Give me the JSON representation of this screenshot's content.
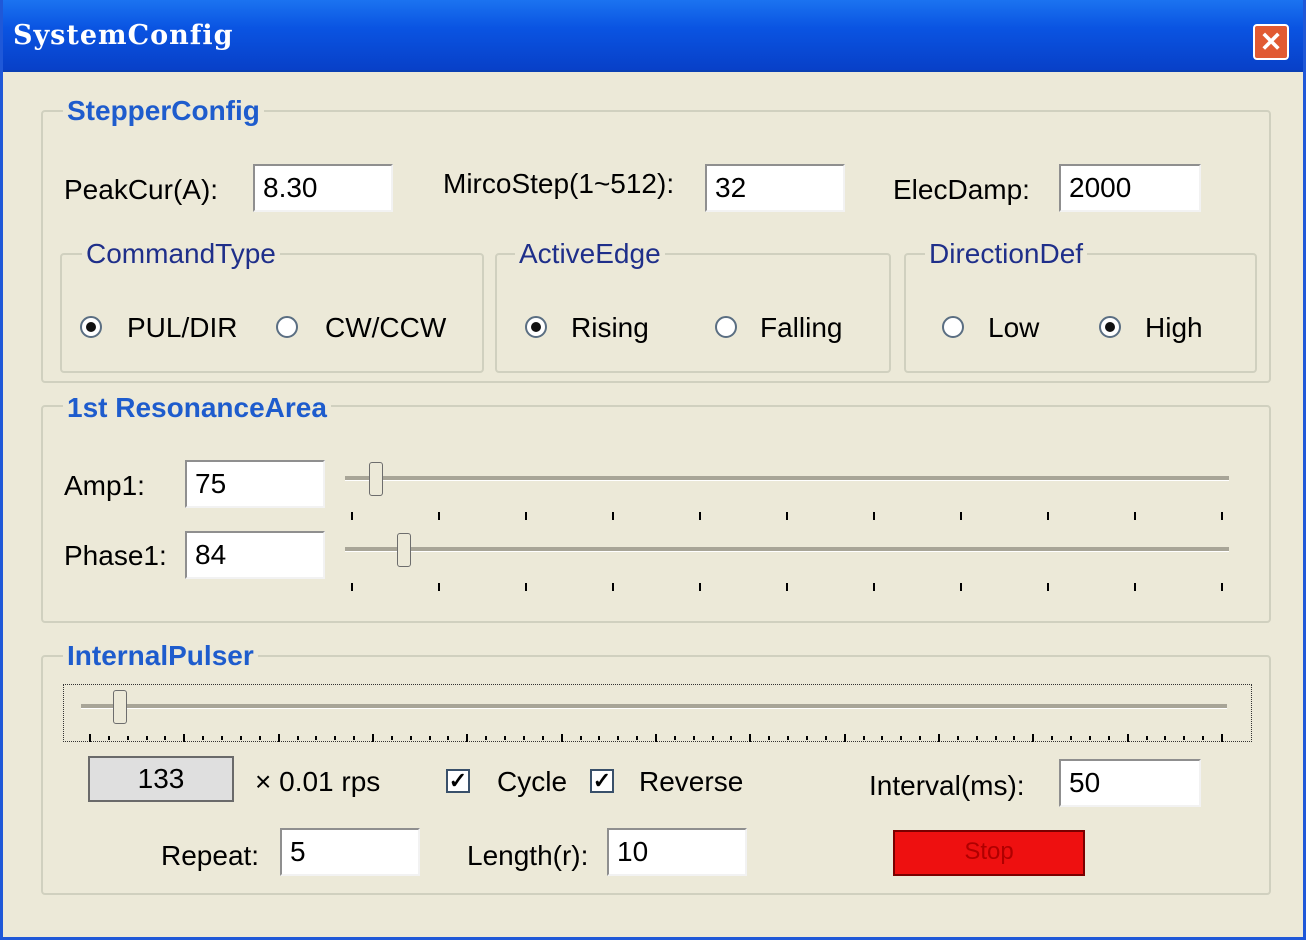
{
  "window": {
    "title": "SystemConfig",
    "close_glyph": "✕"
  },
  "stepper": {
    "title": "StepperConfig",
    "peak_label": "PeakCur(A):",
    "peak_value": "8.30",
    "micro_label": "MircoStep(1~512):",
    "micro_value": "32",
    "damp_label": "ElecDamp:",
    "damp_value": "2000",
    "command_type": {
      "title": "CommandType",
      "options": [
        "PUL/DIR",
        "CW/CCW"
      ],
      "selected": "PUL/DIR"
    },
    "active_edge": {
      "title": "ActiveEdge",
      "options": [
        "Rising",
        "Falling"
      ],
      "selected": "Rising"
    },
    "direction_def": {
      "title": "DirectionDef",
      "options": [
        "Low",
        "High"
      ],
      "selected": "High"
    }
  },
  "resonance": {
    "title": "1st ResonanceArea",
    "amp_label": "Amp1:",
    "amp_value": "75",
    "phase_label": "Phase1:",
    "phase_value": "84"
  },
  "pulser": {
    "title": "InternalPulser",
    "value": "133",
    "unit": "× 0.01 rps",
    "cycle_label": "Cycle",
    "cycle_checked": true,
    "reverse_label": "Reverse",
    "reverse_checked": true,
    "interval_label": "Interval(ms):",
    "interval_value": "50",
    "repeat_label": "Repeat:",
    "repeat_value": "5",
    "length_label": "Length(r):",
    "length_value": "10",
    "stop_label": "Stop",
    "stop_color": "#ee1010"
  }
}
